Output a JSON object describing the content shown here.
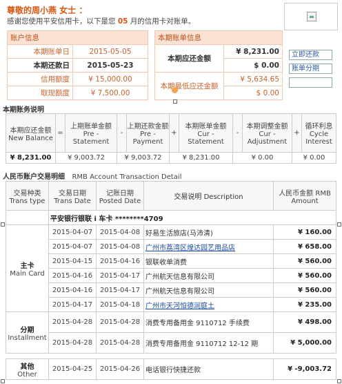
{
  "header": {
    "greeting": "尊敬的周小燕  女士 ：",
    "intro_before": "感谢您使用平安信用卡，以下是您",
    "intro_month": "05",
    "intro_after": "月的信用卡对账单。"
  },
  "account_info": {
    "title": "账户信息",
    "rows": [
      {
        "label": "本期账单日",
        "value": "2015-05-05"
      },
      {
        "label": "本期还款日",
        "value": "2015-05-23"
      },
      {
        "label": "信用额度",
        "value": "¥ 15,000.00"
      },
      {
        "label": "取现额度",
        "value": "¥ 7,500.00"
      }
    ]
  },
  "bill_info": {
    "title": "本期账单信息",
    "amount_due_label": "本期应还金额",
    "amount_due_1": "¥ 8,231.00",
    "amount_due_2": "$ 0.00",
    "min_due_label": "本期最低应还金额",
    "min_due_1": "¥ 5,634.65",
    "min_due_2": "$ 0.00"
  },
  "side_buttons": {
    "repay": "立即还款",
    "installment": "账单分期",
    "blank": ""
  },
  "summary": {
    "title": "本期账务说明",
    "headers": [
      "本期应还金额 New Balance",
      "上期账单金额 Pre - Statement",
      "上期还款金额 Pre - Payment",
      "本期账单金额 Cur - Statement",
      "本期调整金额 Cur - Adjustment",
      "循环利息 Cycle Interest"
    ],
    "operators": [
      "=",
      "-",
      "+",
      "-",
      "+"
    ],
    "values": [
      "¥ 8,231.00",
      "¥ 9,003.72",
      "¥ 9,003.72",
      "¥ 8,231.00",
      "¥ 0.00",
      "¥ 0.00"
    ]
  },
  "transactions": {
    "title_cn": "人民币账户交易明细",
    "title_en": "RMB Account Transaction Detail",
    "headers": {
      "type": "交易种类 Trans type",
      "trans_date": "交易日期 Trans Date",
      "post_date": "记账日期 Posted Date",
      "desc": "交易说明 Description",
      "amount": "人民币金额 RMB Amount"
    },
    "card_line": "平安银行银联 i 车卡 ********4709",
    "groups": [
      {
        "cat_cn": "主卡",
        "cat_en": "Main Card",
        "rows": [
          {
            "trans_date": "2015-04-07",
            "post_date": "2015-04-08",
            "desc": "好易生活旅店(马沛清)",
            "amount": "¥ 160.00",
            "link": false
          },
          {
            "trans_date": "2015-04-07",
            "post_date": "2015-04-08",
            "desc": "广州市荔湾区煌达园艺用品店",
            "amount": "¥ 658.00",
            "link": true
          },
          {
            "trans_date": "2015-04-15",
            "post_date": "2015-04-16",
            "desc": "银联收单消费",
            "amount": "¥ 560.00",
            "link": false
          },
          {
            "trans_date": "2015-04-16",
            "post_date": "2015-04-17",
            "desc": "广州航天信息有限公司",
            "amount": "¥ 560.00",
            "link": false
          },
          {
            "trans_date": "2015-04-16",
            "post_date": "2015-04-17",
            "desc": "广州航天信息有限公司",
            "amount": "¥ 560.00",
            "link": false
          },
          {
            "trans_date": "2015-04-17",
            "post_date": "2015-04-18",
            "desc": "广州市天河恒德润庭土",
            "amount": "¥ 235.00",
            "link": true
          }
        ]
      },
      {
        "cat_cn": "分期",
        "cat_en": "Installment",
        "rows": [
          {
            "trans_date": "2015-04-28",
            "post_date": "2015-04-28",
            "desc": "消费专用备用金 9110712 手续费",
            "amount": "¥ 498.00",
            "link": false
          },
          {
            "trans_date": "2015-04-28",
            "post_date": "2015-04-28",
            "desc": "消费专用备用金 9110712 12-12 期",
            "amount": "¥ 5,000.00",
            "link": false
          }
        ]
      },
      {
        "cat_cn": "其他",
        "cat_en": "Other",
        "rows": [
          {
            "trans_date": "2015-04-25",
            "post_date": "2015-04-26",
            "desc": "电话银行快捷还款",
            "amount": "¥ -9,003.72",
            "link": false
          }
        ]
      }
    ]
  }
}
